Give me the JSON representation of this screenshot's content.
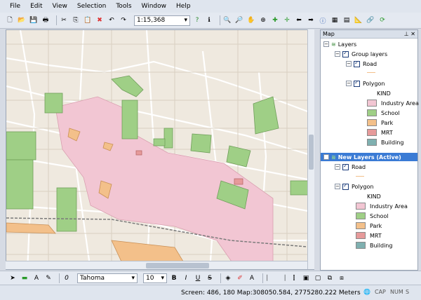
{
  "menu": [
    "File",
    "Edit",
    "View",
    "Selection",
    "Tools",
    "Window",
    "Help"
  ],
  "toolbar": {
    "scale": "1:15,368"
  },
  "panel": {
    "title": "Map"
  },
  "tree": {
    "layers": "Layers",
    "group_layers": "Group layers",
    "road": "Road",
    "polygon": "Polygon",
    "kind": "KIND",
    "legend": [
      "Industry Area",
      "School",
      "Park",
      "MRT",
      "Building"
    ],
    "new_layers": "New Layers (Active)"
  },
  "legend_colors": [
    "#f2c6d3",
    "#9fcf86",
    "#f3c08a",
    "#e69a9a",
    "#7fb0b0"
  ],
  "format_bar": {
    "font": "Tahoma",
    "size": "10"
  },
  "status": {
    "coords": "Screen: 486, 180  Map:308050.584, 2775280.222 Meters",
    "cap": "CAP",
    "num": "NUM",
    "scrl": "S"
  }
}
